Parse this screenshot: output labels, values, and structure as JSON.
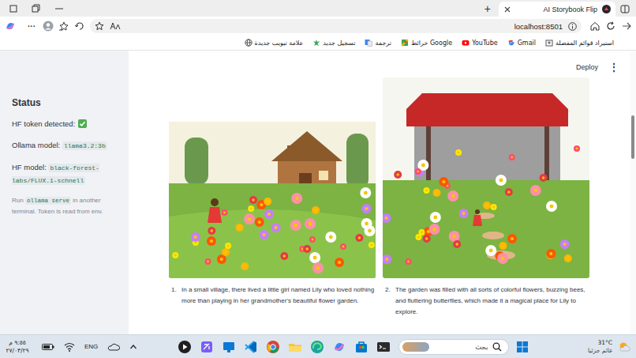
{
  "browser": {
    "tab": {
      "title": "AI Storybook Flip",
      "selected": true
    },
    "new_tab_button": "+",
    "more_button": "···",
    "address": {
      "url": "localhost:8501"
    },
    "bookmarks": [
      {
        "label": "استيراد قوائم المفضلة"
      },
      {
        "label": "Gmail"
      },
      {
        "label": "YouTube"
      },
      {
        "label": "خرائط Google"
      },
      {
        "label": "ترجمة"
      },
      {
        "label": "تسجيل جديد"
      },
      {
        "label": "علامة تبويب جديدة"
      }
    ]
  },
  "app": {
    "sidebar": {
      "heading": "Status",
      "token": {
        "label": "HF token detected:",
        "detected": true
      },
      "models": [
        {
          "label": "Ollama model:",
          "value": "llama3.2:3b"
        },
        {
          "label": "HF model:",
          "value": "black-forest-labs/FLUX.1-schnell"
        }
      ],
      "note": [
        {
          "text": "Run ",
          "code": false
        },
        {
          "text": "ollama serve",
          "code": true
        },
        {
          "text": " in another terminal. Token is read from env.",
          "code": false
        }
      ]
    },
    "header": {
      "deploy": "Deploy",
      "menu": "⋮"
    },
    "pages": [
      {
        "number": "1.",
        "caption": "In a small village, there lived a little girl named Lily who loved nothing more than playing in her grandmother's beautiful flower garden."
      },
      {
        "number": "2.",
        "caption": "The garden was filled with all sorts of colorful flowers, buzzing bees, and fluttering butterflies, which made it a magical place for Lily to explore."
      }
    ]
  },
  "taskbar": {
    "time": "٩:٥٥ م",
    "date": "٢٧/٠٣/٢٩",
    "language": "ENG",
    "search": {
      "placeholder": "بحث"
    },
    "weather": {
      "temperature": "31°C",
      "condition": "غائم جزئيا"
    }
  }
}
